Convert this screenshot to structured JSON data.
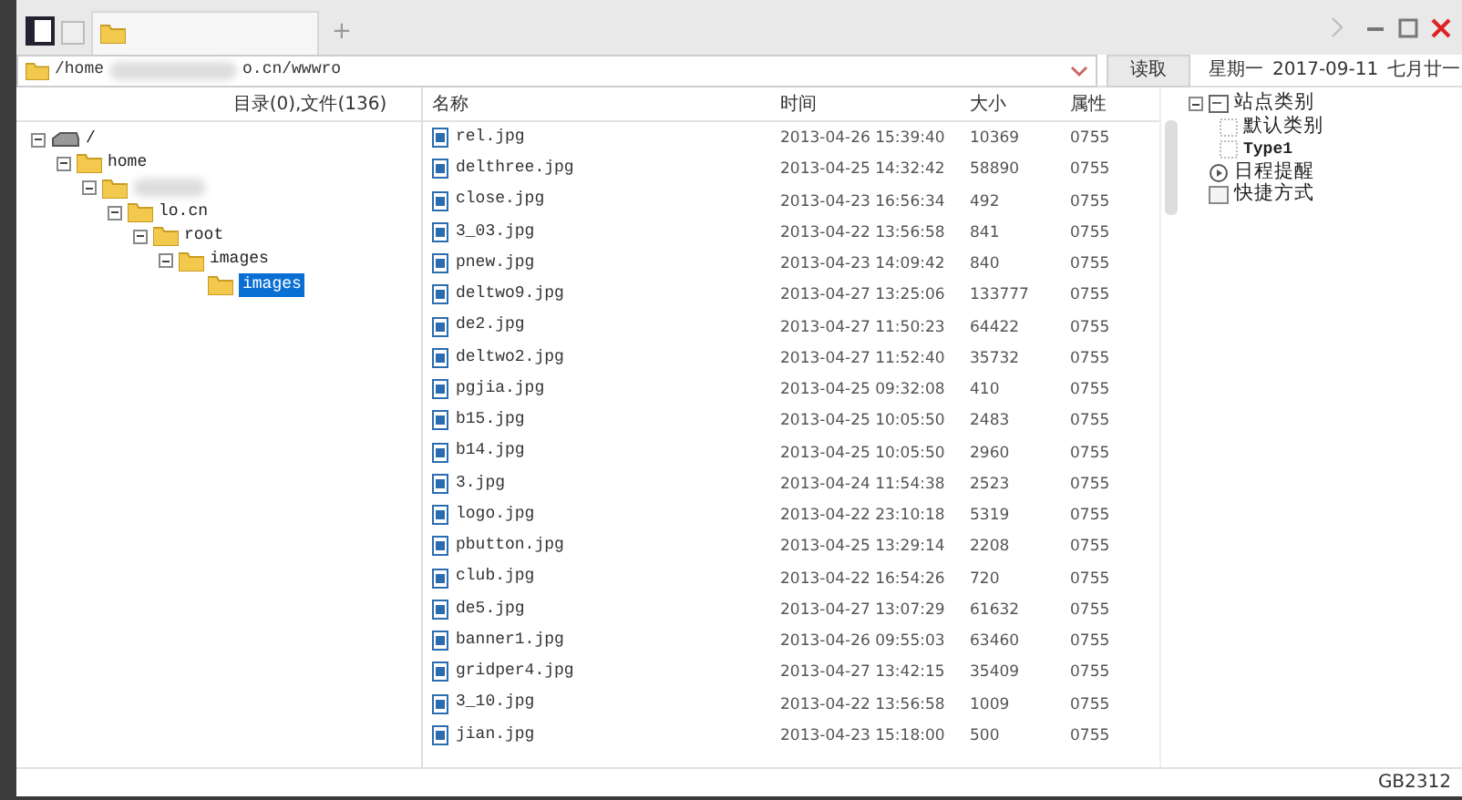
{
  "address": {
    "start": "/home",
    "end": "o.cn/wwwro"
  },
  "new_tab": "+",
  "read_button": "读取",
  "date": {
    "weekday": "星期一",
    "date": "2017-09-11",
    "lunar": "七月廿一"
  },
  "left_header": "目录(0),文件(136)",
  "tree": [
    {
      "label": "/",
      "kind": "drive",
      "expanded": true,
      "selected": false,
      "children": [
        {
          "label": "home",
          "kind": "folder",
          "expanded": true,
          "selected": false,
          "children": [
            {
              "kind": "folder",
              "expanded": true,
              "selected": false,
              "children": [
                {
                  "label": "lo.cn",
                  "kind": "folder",
                  "expanded": true,
                  "selected": false,
                  "children": [
                    {
                      "label": "root",
                      "kind": "folder",
                      "expanded": true,
                      "selected": false,
                      "children": [
                        {
                          "label": "images",
                          "kind": "folder",
                          "expanded": true,
                          "selected": false,
                          "children": [
                            {
                              "label": "images",
                              "kind": "folder",
                              "selected": true
                            }
                          ]
                        }
                      ]
                    }
                  ]
                }
              ]
            }
          ]
        }
      ]
    }
  ],
  "columns": [
    "名称",
    "时间",
    "大小",
    "属性"
  ],
  "files": [
    [
      "rel.jpg",
      "2013-04-26 15:39:40",
      "10369",
      "0755"
    ],
    [
      "delthree.jpg",
      "2013-04-25 14:32:42",
      "58890",
      "0755"
    ],
    [
      "close.jpg",
      "2013-04-23 16:56:34",
      "492",
      "0755"
    ],
    [
      "3_03.jpg",
      "2013-04-22 13:56:58",
      "841",
      "0755"
    ],
    [
      "pnew.jpg",
      "2013-04-23 14:09:42",
      "840",
      "0755"
    ],
    [
      "deltwo9.jpg",
      "2013-04-27 13:25:06",
      "133777",
      "0755"
    ],
    [
      "de2.jpg",
      "2013-04-27 11:50:23",
      "64422",
      "0755"
    ],
    [
      "deltwo2.jpg",
      "2013-04-27 11:52:40",
      "35732",
      "0755"
    ],
    [
      "pgjia.jpg",
      "2013-04-25 09:32:08",
      "410",
      "0755"
    ],
    [
      "b15.jpg",
      "2013-04-25 10:05:50",
      "2483",
      "0755"
    ],
    [
      "b14.jpg",
      "2013-04-25 10:05:50",
      "2960",
      "0755"
    ],
    [
      "3.jpg",
      "2013-04-24 11:54:38",
      "2523",
      "0755"
    ],
    [
      "logo.jpg",
      "2013-04-22 23:10:18",
      "5319",
      "0755"
    ],
    [
      "pbutton.jpg",
      "2013-04-25 13:29:14",
      "2208",
      "0755"
    ],
    [
      "club.jpg",
      "2013-04-22 16:54:26",
      "720",
      "0755"
    ],
    [
      "de5.jpg",
      "2013-04-27 13:07:29",
      "61632",
      "0755"
    ],
    [
      "banner1.jpg",
      "2013-04-26 09:55:03",
      "63460",
      "0755"
    ],
    [
      "gridper4.jpg",
      "2013-04-27 13:42:15",
      "35409",
      "0755"
    ],
    [
      "3_10.jpg",
      "2013-04-22 13:56:58",
      "1009",
      "0755"
    ],
    [
      "jian.jpg",
      "2013-04-23 15:18:00",
      "500",
      "0755"
    ]
  ],
  "side_tree": [
    {
      "label": "站点类别",
      "kind": "category",
      "expanded": true,
      "children": [
        {
          "label": "默认类别",
          "kind": "item"
        },
        {
          "label": "Type1",
          "kind": "item"
        }
      ]
    },
    {
      "label": "日程提醒",
      "kind": "schedule"
    },
    {
      "label": "快捷方式",
      "kind": "shortcut"
    }
  ],
  "encoding": "GB2312"
}
